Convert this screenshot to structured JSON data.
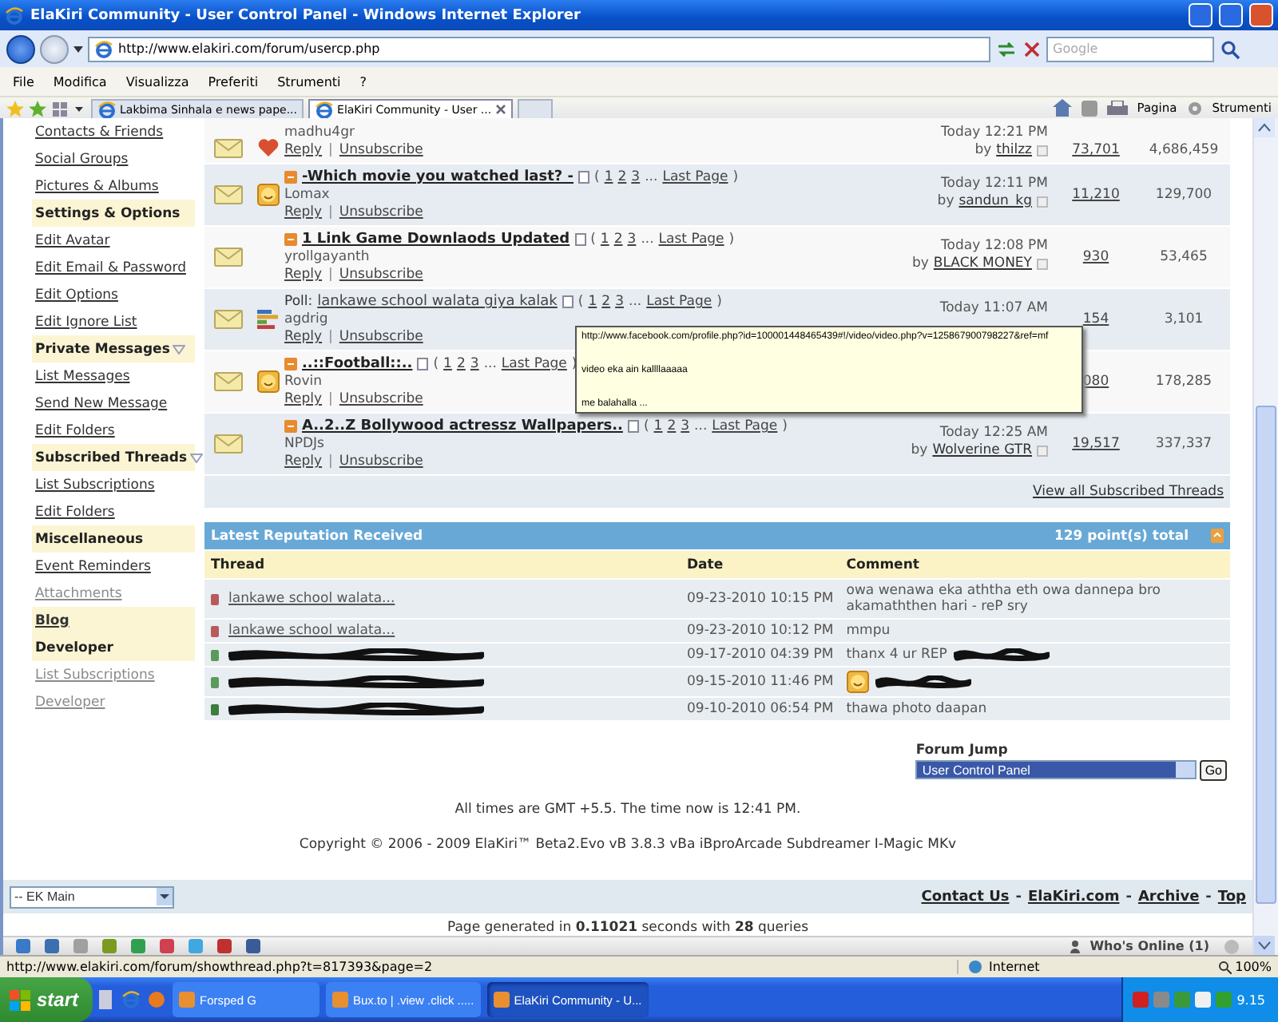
{
  "window": {
    "title": "ElaKiri Community - User Control Panel - Windows Internet Explorer"
  },
  "address_bar": {
    "url": "http://www.elakiri.com/forum/usercp.php"
  },
  "search": {
    "placeholder": "Google"
  },
  "menu": [
    "File",
    "Modifica",
    "Visualizza",
    "Preferiti",
    "Strumenti",
    "?"
  ],
  "tabs": [
    {
      "label": "Lakbima Sinhala e news pape...",
      "selected": false
    },
    {
      "label": "ElaKiri Community - User ...",
      "selected": true
    }
  ],
  "command_bar": [
    "Pagina",
    "Strumenti"
  ],
  "sidebar": {
    "items": [
      {
        "kind": "link",
        "label": "Contacts & Friends"
      },
      {
        "kind": "link",
        "label": "Social Groups"
      },
      {
        "kind": "link",
        "label": "Pictures & Albums"
      },
      {
        "kind": "header",
        "label": "Settings & Options"
      },
      {
        "kind": "link",
        "label": "Edit Avatar"
      },
      {
        "kind": "link",
        "label": "Edit Email & Password"
      },
      {
        "kind": "link",
        "label": "Edit Options"
      },
      {
        "kind": "link",
        "label": "Edit Ignore List"
      },
      {
        "kind": "header",
        "label": "Private Messages",
        "has_menu": true
      },
      {
        "kind": "link",
        "label": "List Messages"
      },
      {
        "kind": "link",
        "label": "Send New Message"
      },
      {
        "kind": "link",
        "label": "Edit Folders"
      },
      {
        "kind": "header",
        "label": "Subscribed Threads",
        "has_menu": true
      },
      {
        "kind": "link",
        "label": "List Subscriptions"
      },
      {
        "kind": "link",
        "label": "Edit Folders"
      },
      {
        "kind": "header",
        "label": "Miscellaneous"
      },
      {
        "kind": "link",
        "label": "Event Reminders"
      },
      {
        "kind": "link",
        "label": "Attachments",
        "dim": true
      },
      {
        "kind": "header_link",
        "label": "Blog"
      },
      {
        "kind": "header",
        "label": "Developer"
      },
      {
        "kind": "link",
        "label": "List Subscriptions",
        "dim": true
      },
      {
        "kind": "link",
        "label": "Developer",
        "dim": true
      }
    ]
  },
  "subscribed_threads": {
    "rows": [
      {
        "kind": "heart",
        "author": "madhu4gr",
        "actions": [
          "Reply",
          "|",
          "Unsubscribe"
        ],
        "date": "Today 12:21 PM",
        "by": "by",
        "last_poster": "thilzz",
        "replies": "73,701",
        "views": "4,686,459"
      },
      {
        "kind": "smiley",
        "title": "-Which movie you watched last? -",
        "page_nav": [
          {
            "kind": "text",
            "text": "("
          },
          {
            "kind": "link",
            "text": "1"
          },
          {
            "kind": "link",
            "text": "2"
          },
          {
            "kind": "link",
            "text": "3"
          },
          {
            "kind": "text",
            "text": "..."
          },
          {
            "kind": "link",
            "text": "Last Page"
          },
          {
            "kind": "text",
            "text": ")"
          }
        ],
        "author": "Lomax",
        "actions": [
          "Reply",
          "|",
          "Unsubscribe"
        ],
        "date": "Today 12:11 PM",
        "by": "by",
        "last_poster": "sandun_kg",
        "replies": "11,210",
        "views": "129,700"
      },
      {
        "kind": "plain",
        "title": "1 Link Game Downlaods Updated",
        "page_nav": [
          {
            "kind": "text",
            "text": "("
          },
          {
            "kind": "link",
            "text": "1"
          },
          {
            "kind": "link",
            "text": "2"
          },
          {
            "kind": "link",
            "text": "3"
          },
          {
            "kind": "text",
            "text": "..."
          },
          {
            "kind": "link",
            "text": "Last Page"
          },
          {
            "kind": "text",
            "text": ")"
          }
        ],
        "author": "yrollgayanth",
        "actions": [
          "Reply",
          "|",
          "Unsubscribe"
        ],
        "date": "Today 12:08 PM",
        "by": "by",
        "last_poster": "BLACK MONEY",
        "replies": "930",
        "views": "53,465"
      },
      {
        "kind": "poll",
        "prefix": "Poll:",
        "title": "lankawe school walata giya kalak",
        "page_nav": [
          {
            "kind": "text",
            "text": "("
          },
          {
            "kind": "link",
            "text": "1"
          },
          {
            "kind": "link",
            "text": "2"
          },
          {
            "kind": "link",
            "text": "3"
          },
          {
            "kind": "text",
            "text": "..."
          },
          {
            "kind": "link",
            "text": "Last Page"
          },
          {
            "kind": "text",
            "text": ")"
          }
        ],
        "author": "agdrig",
        "actions": [
          "Reply",
          "|",
          "Unsubscribe"
        ],
        "date": "Today 11:07 AM",
        "replies": "154",
        "views": "3,101"
      },
      {
        "kind": "smiley",
        "title": "..::Football::..",
        "page_nav": [
          {
            "kind": "text",
            "text": "("
          },
          {
            "kind": "link",
            "text": "1"
          },
          {
            "kind": "link",
            "text": "2"
          },
          {
            "kind": "link",
            "text": "3"
          },
          {
            "kind": "text",
            "text": "..."
          },
          {
            "kind": "link",
            "text": "Last Page"
          },
          {
            "kind": "text",
            "text": ")"
          }
        ],
        "author": "Rovin",
        "actions": [
          "Reply",
          "|",
          "Unsubscribe"
        ],
        "replies": "080",
        "views": "178,285"
      },
      {
        "kind": "plain",
        "title": "A..2..Z Bollywood actressz Wallpapers..",
        "page_nav": [
          {
            "kind": "text",
            "text": "("
          },
          {
            "kind": "link",
            "text": "1"
          },
          {
            "kind": "link",
            "text": "2"
          },
          {
            "kind": "link",
            "text": "3"
          },
          {
            "kind": "text",
            "text": "..."
          },
          {
            "kind": "link",
            "text": "Last Page"
          },
          {
            "kind": "text",
            "text": ")"
          }
        ],
        "author": "NPDJs",
        "actions": [
          "Reply",
          "|",
          "Unsubscribe"
        ],
        "date": "Today 12:25 AM",
        "by": "by",
        "last_poster": "Wolverine GTR",
        "replies": "19,517",
        "views": "337,337"
      }
    ],
    "footer_link": "View all Subscribed Threads"
  },
  "tooltip": {
    "lines": [
      "http://www.facebook.com/profile.php?id=100001448465439#!/video/video.php?v=125867900798227&ref=mf",
      "video eka ain kallllaaaaa",
      "me balahalla ..."
    ]
  },
  "reputation": {
    "title": "Latest Reputation Received",
    "total": "129 point(s) total",
    "columns": [
      "Thread",
      "Date",
      "Comment"
    ],
    "rows": [
      {
        "color": "#b85a5a",
        "thread": "lankawe school walata...",
        "date": "09-23-2010 10:15 PM",
        "comment": "owa wenawa eka aththa eth owa dannepa bro akamaththen hari - reP sry"
      },
      {
        "color": "#b85a5a",
        "thread": "lankawe school walata...",
        "date": "09-23-2010 10:12 PM",
        "comment": "mmpu"
      },
      {
        "color": "#5a9a5a",
        "thread_redacted": true,
        "date": "09-17-2010 04:39 PM",
        "comment": "thanx 4 ur REP",
        "comment_redacted": true
      },
      {
        "color": "#5a9a5a",
        "thread_redacted": true,
        "date": "09-15-2010 11:46 PM",
        "comment_redacted": true,
        "smiley": true
      },
      {
        "color": "#3d7d3d",
        "thread_redacted": true,
        "date": "09-10-2010 06:54 PM",
        "comment": "thawa photo daapan"
      }
    ]
  },
  "forum_jump": {
    "label": "Forum Jump",
    "value": "User Control Panel",
    "button": "Go"
  },
  "time_note": "All times are GMT +5.5. The time now is 12:41 PM.",
  "copyright": "Copyright © 2006 - 2009 ElaKiri™ Beta2.Evo vB 3.8.3 vBa iBproArcade Subdreamer I-Magic MKv",
  "footer": {
    "style_select": "-- EK Main",
    "links": [
      {
        "kind": "link",
        "text": "Contact Us"
      },
      {
        "kind": "text",
        "text": "-"
      },
      {
        "kind": "link",
        "text": "ElaKiri.com"
      },
      {
        "kind": "text",
        "text": "-"
      },
      {
        "kind": "link",
        "text": "Archive"
      },
      {
        "kind": "text",
        "text": "-"
      },
      {
        "kind": "link",
        "text": "Top"
      }
    ],
    "generated": "Page generated in **0.11021** seconds with **28** queries"
  },
  "toolbar": {
    "who_online": "Who's Online (1)"
  },
  "status_bar": {
    "url": "http://www.elakiri.com/forum/showthread.php?t=817393&page=2",
    "zone": "Internet",
    "zoom": "100%"
  },
  "taskbar": {
    "start": "start",
    "tasks": [
      {
        "label": "Forsped G",
        "selected": false
      },
      {
        "label": "Bux.to | .view .click .....",
        "selected": false
      },
      {
        "label": "ElaKiri Community - U...",
        "selected": true
      }
    ],
    "clock": "9.15"
  }
}
